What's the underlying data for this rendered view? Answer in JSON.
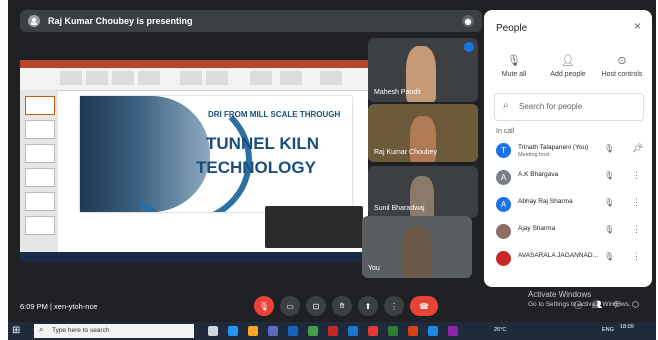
{
  "presenter_bar": {
    "text": "Raj Kumar Choubey is presenting"
  },
  "shared_screen": {
    "slide_line1": "DRI FROM MILL SCALE THROUGH",
    "slide_line2": "TUNNEL KILN",
    "slide_line3": "TECHNOLOGY"
  },
  "tiles": [
    {
      "name": "Mahesh Pandit"
    },
    {
      "name": "Raj Kumar Choubey"
    },
    {
      "name": "Sunil Bharadwaj"
    },
    {
      "name": "You"
    }
  ],
  "people_panel": {
    "title": "People",
    "close": "×",
    "actions": [
      {
        "label": "Mute all",
        "icon": "mic-off-icon"
      },
      {
        "label": "Add people",
        "icon": "person-add-icon"
      },
      {
        "label": "Host controls",
        "icon": "toggle-icon"
      }
    ],
    "search_placeholder": "Search for people",
    "section_label": "In call",
    "participants": [
      {
        "initial": "T",
        "name": "Trinath Talapaneni (You)",
        "sub": "Meeting host",
        "color": "#1a73e8"
      },
      {
        "initial": "A",
        "name": "A.K Bhargava",
        "sub": "",
        "color": "#7b7f86"
      },
      {
        "initial": "A",
        "name": "Abhay Raj Sharma",
        "sub": "",
        "color": "#1a73e8"
      },
      {
        "initial": "",
        "name": "Ajay Sharma",
        "sub": "",
        "color": "#8d6e63"
      },
      {
        "initial": "",
        "name": "AVASARALA JAGANNAD...",
        "sub": "",
        "color": "#c62828"
      }
    ]
  },
  "watermark": {
    "line1": "Activate Windows",
    "line2": "Go to Settings to activate Windows."
  },
  "bottom_bar": {
    "time_code": "6:09 PM  |  xen-ytoh-nce"
  },
  "windows_taskbar": {
    "search_placeholder": "Type here to search",
    "temperature": "26°C",
    "language": "ENG",
    "time": "18:09"
  }
}
